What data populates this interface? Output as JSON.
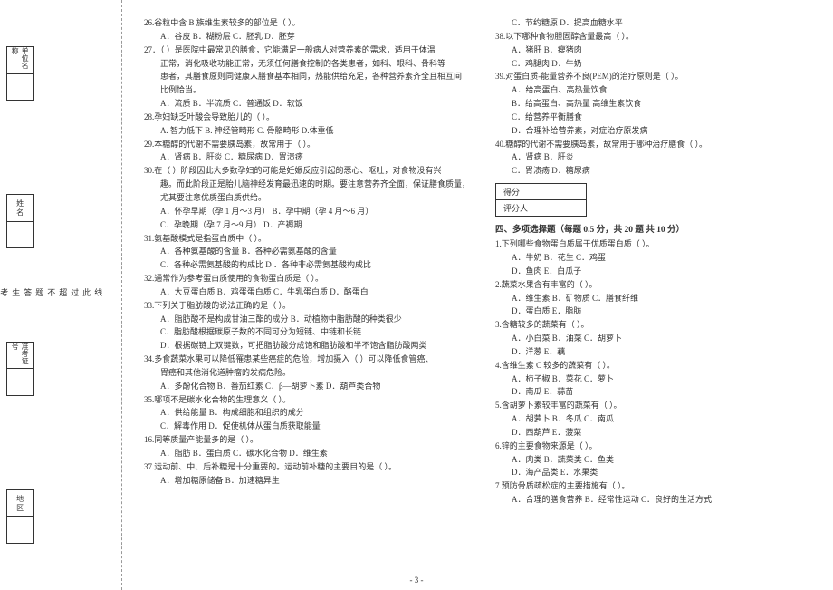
{
  "binding": {
    "sep_chars": [
      "线",
      "此",
      "过",
      "超",
      "不",
      "题",
      "答",
      "生",
      "考"
    ],
    "labels": [
      "单位名称",
      "姓 名",
      "准考证号",
      "地 区"
    ]
  },
  "left": {
    "q26": "26.谷粒中含 B 族维生素较多的部位是（     ）。",
    "q26o": "A．谷皮       B．糊粉层       C．胚乳       D．胚芽",
    "q27a": "27．（     ）是医院中最常见的膳食，它能满足一般病人对营养素的需求，适用于体温",
    "q27b": "正常，消化吸收功能正常，无须任何膳食控制的各类患者，如科、眼科、骨科等",
    "q27c": "患者，其膳食原则同健康人膳食基本相同，热能供给充足，各种营养素齐全且相互间",
    "q27d": "比例恰当。",
    "q27o": "A．流质       B．半流质       C．普通饭       D．软饭",
    "q28": "28.孕妇缺乏叶酸会导致胎儿的（     ）。",
    "q28o": "A. 智力低下  B. 神经管畸形   C. 骨骼畸形   D.体重低",
    "q29": "29.本糖醇的代谢不需要胰岛素，故常用于（     ）。",
    "q29o": "A．肾病      B．肝炎     C．糖尿病      D．胃溃疡",
    "q30a": "30.在（     ）阶段因此大多数孕妇的可能是妊娠反应引起的恶心、呕吐，对食物没有兴",
    "q30b": "趣。而此阶段正是胎儿脑神经发育最迅速的时期。要注意营养齐全面，保证膳食质量，",
    "q30c": "尤其要注意优质蛋白质供给。",
    "q30o1": "A．怀孕早期（孕 1 月～3 月）     B．孕中期（孕 4 月～6 月）",
    "q30o2": "C．孕晚期（孕 7 月～9 月）     D．产褥期",
    "q31": "31.氨基酸模式是指蛋白质中（     ）。",
    "q31o1": "A．各种氨基酸的含量              B．各种必需氨基酸的含量",
    "q31o2": "C．各种必需氨基酸的构成比     D ．各种非必需氨基酸构成比",
    "q32": "32.通常作为参考蛋白质使用的食物蛋白质是（     ）。",
    "q32o": "A．大豆蛋白质   B．鸡蛋蛋白质   C．牛乳蛋白质   D．酪蛋白",
    "q33": "33.下列关于脂肪酸的说法正确的是（     ）。",
    "q33o1": "A．脂肪酸不是构成甘油三酯的成分       B．动植物中脂肪酸的种类很少",
    "q33o2": "C．脂肪酸根据碳原子数的不同可分为短链、中链和长链",
    "q33o3": "D．根据碳链上双键数，可把脂肪酸分成饱和脂肪酸和半不饱含脂肪酸两类",
    "q34a": "34.多食蔬菜水果可以降低罹患某些癌症的危险，增加摄入（     ）可以降低食管癌、",
    "q34b": "胃癌和其他消化道肿瘤的发病危险。",
    "q34o": "A．多酚化合物   B．番茄红素   C．β—胡萝卜素 D．葫芦类合物",
    "q35": "35.哪项不是碳水化合物的生理意义（     ）。",
    "q35o1": "A．供给能量                         B．构成细胞和组织的成分",
    "q35o2": "C．解毒作用                         D．促使机体从蛋白质获取能量",
    "q36": "16.同等质量产能量多的是（     ）。",
    "q36o": "A．脂肪       B．蛋白质               C．碳水化合物   D．维生素",
    "q37": "37.运动前、中、后补糖是十分重要的。运动前补糖的主要目的是（     ）。",
    "q37o": "A．增加糖原储备   B．加速糖异生"
  },
  "right": {
    "q37o2": "C．节约糖原   D．提高血糖水平",
    "q38": "38.以下哪种食物胆固醇含量最高（     ）。",
    "q38o1": "A．猪肝 B．瘦猪肉",
    "q38o2": "C．鸡腿肉 D．牛奶",
    "q39": "39.对蛋白质-能量营养不良(PEM)的治疗原则是（     ）。",
    "q39o1": "A．给高蛋白、高热量饮食",
    "q39o2": "B．给高蛋白、高热量 高维生素饮食",
    "q39o3": "C．给营养平衡膳食",
    "q39o4": "D．合理补给营养素，对症治疗原发病",
    "q40": "40.糖醇的代谢不需要胰岛素，故常用于哪种治疗膳食（     ）。",
    "q40o1": "A．肾病 B．肝炎",
    "q40o2": "C．胃溃疡 D．糖尿病",
    "score_label1": "得分",
    "score_label2": "评分人",
    "section4": "四、多项选择题（每题 0.5 分，共 20 题   共 10 分）",
    "m1": "1.下列哪些食物蛋白质属于优质蛋白质（       ）。",
    "m1o1": "A．牛奶   B．花生  C．鸡蛋",
    "m1o2": "D．鱼肉 E．白瓜子",
    "m2": "2.蔬菜水果含有丰富的（       ）。",
    "m2o1": "A．维生素  B．矿物质   C．膳食纤维",
    "m2o2": "D．蛋白质 E．脂肪",
    "m3": "3.含糖较多的蔬菜有（       ）。",
    "m3o1": "A．小白菜 B．油菜 C．胡萝卜",
    "m3o2": "D．洋葱   E．藕",
    "m4": "4.含维生素 C 较多的蔬菜有（       ）。",
    "m4o1": "A．柿子椒   B．菜花         C．萝卜",
    "m4o2": "D．南瓜 E．蒜苗",
    "m5": "5.含胡萝卜素较丰富的蔬菜有（       ）。",
    "m5o1": "A．胡萝卜   B．冬瓜 C．南瓜",
    "m5o2": "D．西葫芦   E．菠菜",
    "m6": "6.锌的主要食物来源是（       ）。",
    "m6o1": "A．肉类 B．蔬菜类 C．鱼类",
    "m6o2": "D．海产品类 E．水果类",
    "m7": "7.预防骨质疏松症的主要措施有（       ）。",
    "m7o1": "A．合理的膳食营养   B．经常性运动 C．良好的生活方式"
  },
  "page_num": "- 3 -"
}
